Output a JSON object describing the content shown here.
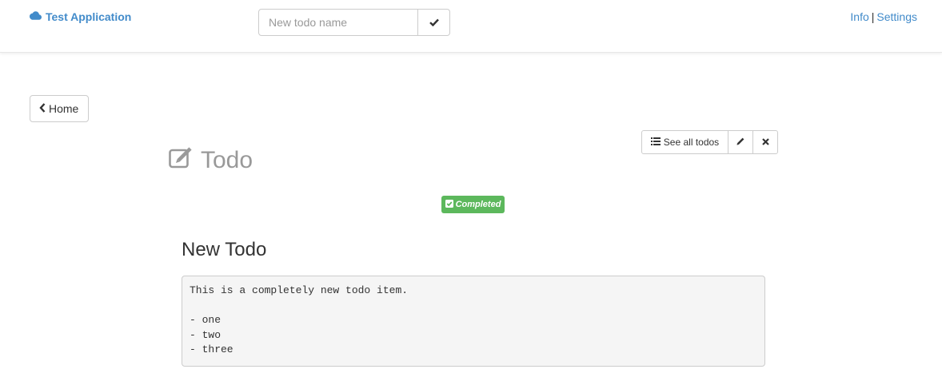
{
  "navbar": {
    "brand_label": "Test Application",
    "new_todo_placeholder": "New todo name",
    "info_link": "Info",
    "separator": "|",
    "settings_link": "Settings"
  },
  "home_button": {
    "label": "Home"
  },
  "toolbar": {
    "see_all_label": "See all todos"
  },
  "page": {
    "title": "Todo",
    "status_badge": "Completed"
  },
  "todo": {
    "name": "New Todo",
    "description": "This is a completely new todo item.\n\n- one\n- two\n- three"
  },
  "colors": {
    "link": "#428bca",
    "success": "#5cb85c",
    "muted_title": "#999999"
  }
}
